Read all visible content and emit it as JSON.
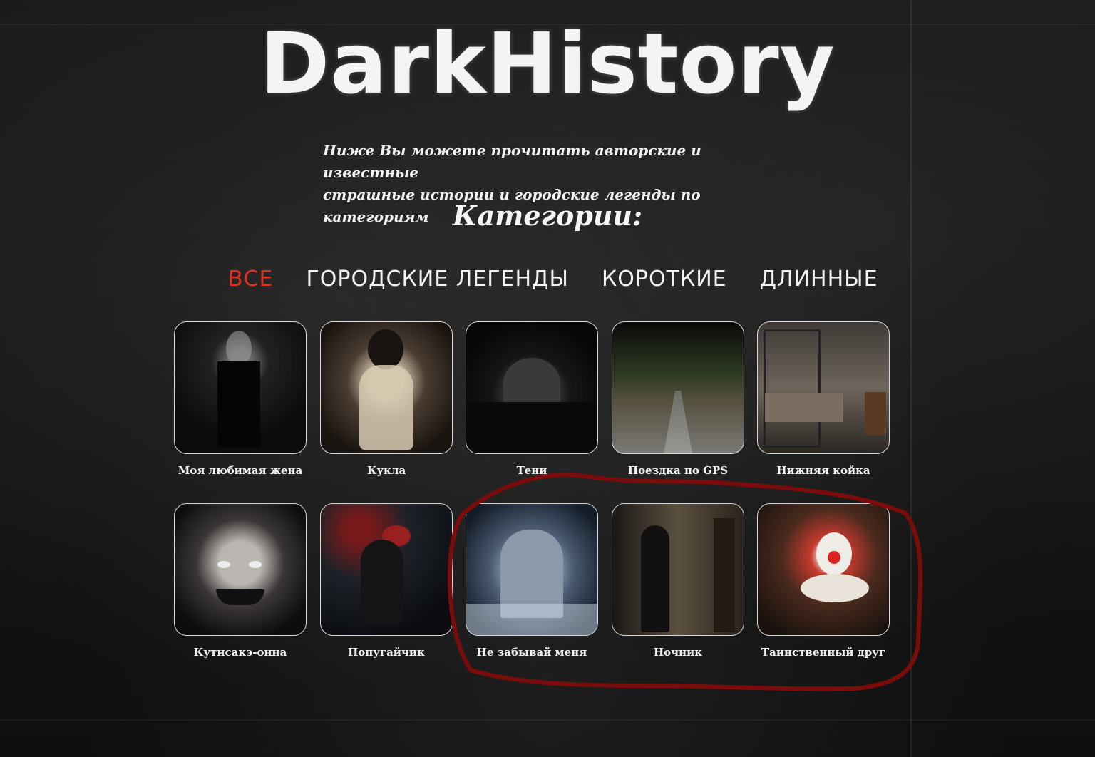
{
  "header": {
    "logo": "DarkHistory",
    "subtitle_line1": "Ниже Вы можете прочитать авторские и известные",
    "subtitle_line2": "страшные истории и городские легенды по категориям",
    "categories_title": "Категории:"
  },
  "tabs": [
    {
      "label": "ВСЕ",
      "active": true
    },
    {
      "label": "ГОРОДСКИЕ ЛЕГЕНДЫ",
      "active": false
    },
    {
      "label": "КОРОТКИЕ",
      "active": false
    },
    {
      "label": "ДЛИННЫЕ",
      "active": false
    }
  ],
  "stories": [
    {
      "title": "Моя любимая жена"
    },
    {
      "title": "Кукла"
    },
    {
      "title": "Тени"
    },
    {
      "title": "Поездка по GPS"
    },
    {
      "title": "Нижняя койка"
    },
    {
      "title": "Кутисакэ-онна"
    },
    {
      "title": "Попугайчик"
    },
    {
      "title": "Не забывай меня"
    },
    {
      "title": "Ночник"
    },
    {
      "title": "Таинственный друг"
    }
  ],
  "colors": {
    "active_tab": "#e0301e",
    "annotation": "#7a0c0c"
  }
}
